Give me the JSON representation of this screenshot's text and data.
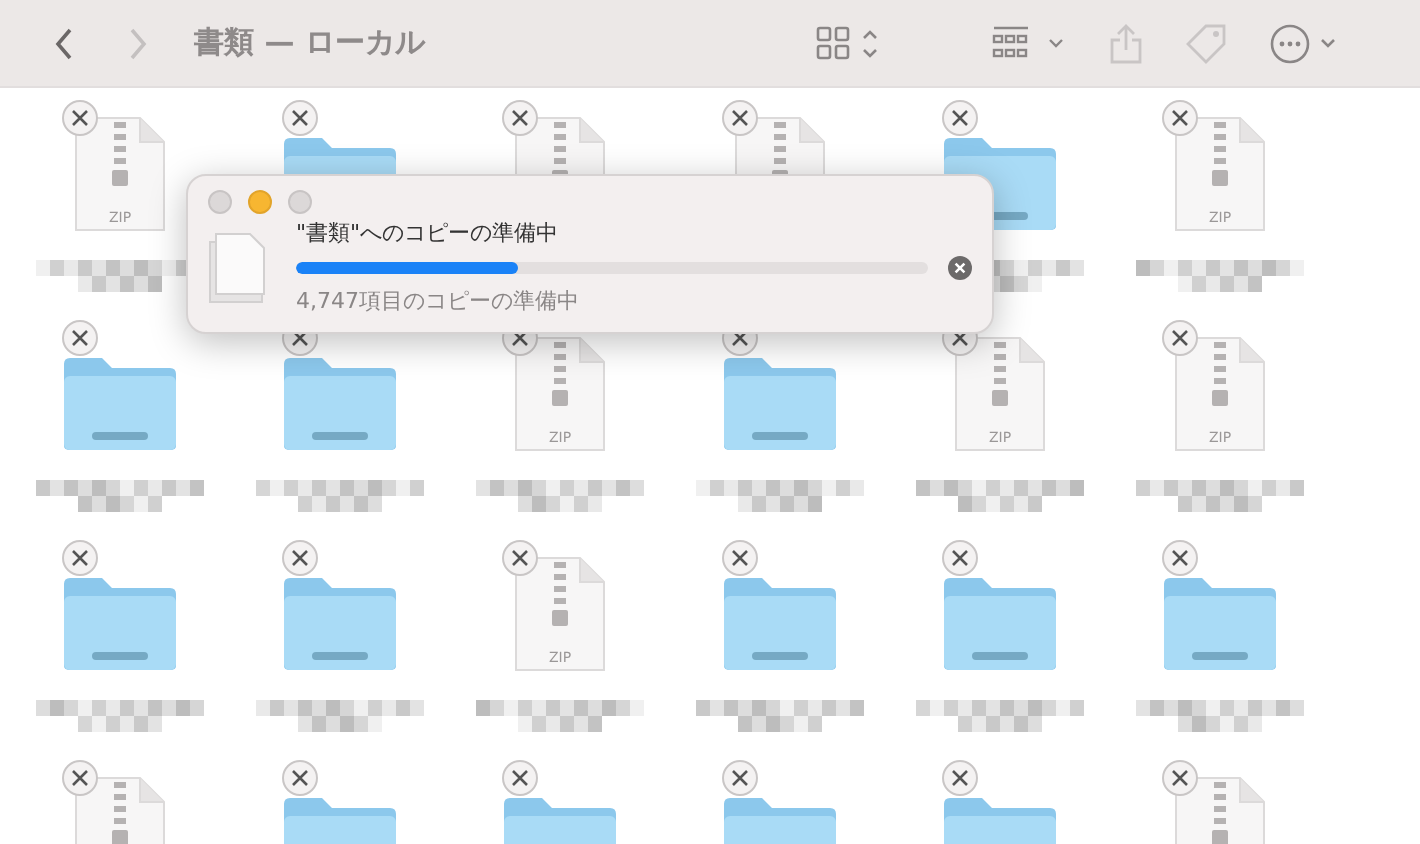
{
  "toolbar": {
    "title": "書類 — ローカル",
    "back_enabled": true,
    "forward_enabled": false
  },
  "items": [
    {
      "kind": "zip",
      "tag": "ZIP",
      "name": {
        "kind": "pixelated"
      }
    },
    {
      "kind": "folder"
    },
    {
      "kind": "zip"
    },
    {
      "kind": "zip"
    },
    {
      "kind": "folder",
      "name": {
        "kind": "pixelated"
      }
    },
    {
      "kind": "zip",
      "tag": "ZIP",
      "name": {
        "kind": "pixelated"
      }
    },
    {
      "kind": "folder",
      "name": {
        "kind": "pixelated"
      }
    },
    {
      "kind": "folder",
      "name": {
        "kind": "pixelated"
      }
    },
    {
      "kind": "zip",
      "tag": "ZIP",
      "name": {
        "kind": "pixelated"
      }
    },
    {
      "kind": "folder",
      "name": {
        "kind": "pixelated"
      }
    },
    {
      "kind": "zip",
      "tag": "ZIP",
      "name": {
        "kind": "pixelated"
      }
    },
    {
      "kind": "zip",
      "tag": "ZIP",
      "name": {
        "kind": "pixelated"
      }
    },
    {
      "kind": "folder",
      "name": {
        "kind": "pixelated"
      }
    },
    {
      "kind": "folder",
      "name": {
        "kind": "pixelated"
      }
    },
    {
      "kind": "zip",
      "tag": "ZIP",
      "name": {
        "kind": "pixelated"
      }
    },
    {
      "kind": "folder",
      "name": {
        "kind": "pixelated"
      }
    },
    {
      "kind": "folder",
      "name": {
        "kind": "pixelated"
      }
    },
    {
      "kind": "folder",
      "name": {
        "kind": "pixelated"
      }
    },
    {
      "kind": "zip"
    },
    {
      "kind": "folder"
    },
    {
      "kind": "folder"
    },
    {
      "kind": "folder"
    },
    {
      "kind": "folder"
    },
    {
      "kind": "zip"
    }
  ],
  "dialog": {
    "title": "\"書類\"へのコピーの準備中",
    "level": 0.35,
    "status": "4,747項目のコピーの準備中"
  }
}
